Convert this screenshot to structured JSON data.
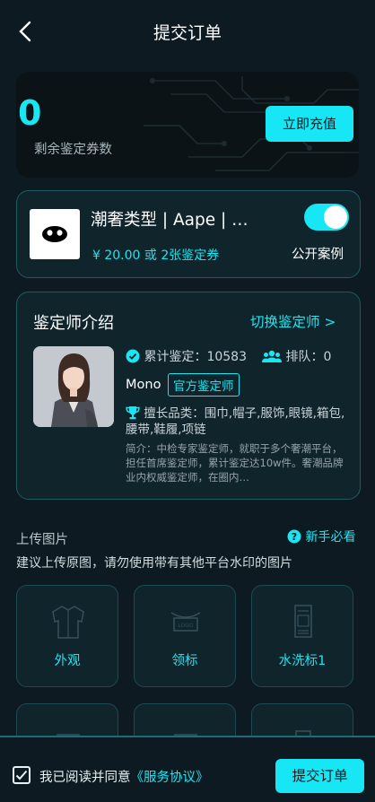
{
  "nav": {
    "title": "提交订单"
  },
  "balance": {
    "count": "0",
    "label": "剩余鉴定券数",
    "recharge_label": "立即充值"
  },
  "product": {
    "title": "潮奢类型 | Aape | …",
    "price": "¥ 20.00 或 2张鉴定券",
    "public_toggle_on": true,
    "public_label": "公开案例"
  },
  "appraiser": {
    "section_title": "鉴定师介绍",
    "switch_label": "切换鉴定师 >",
    "stat_count": "累计鉴定：10583",
    "stat_queue": "排队：0",
    "name": "Mono",
    "badge": "官方鉴定师",
    "skills": "擅长品类：围巾,帽子,服饰,眼镜,箱包,腰带,鞋履,项链",
    "intro": "简介：中检专家鉴定师，就职于多个奢潮平台，担任首席鉴定师，累计鉴定达10w件。奢潮品牌业内权威鉴定师，在圈内…"
  },
  "upload": {
    "title": "上传图片",
    "guide_label": "新手必看",
    "tip": "建议上传原图，请勿使用带有其他平台水印的图片",
    "tiles": [
      {
        "label": "外观",
        "icon": "jacket-icon"
      },
      {
        "label": "领标",
        "icon": "collar-label-icon"
      },
      {
        "label": "水洗标1",
        "icon": "wash-label-icon"
      }
    ]
  },
  "footer": {
    "agree_prefix": "我已阅读并同意",
    "agree_link": "《服务协议》",
    "submit_label": "提交订单",
    "checked": true
  },
  "colors": {
    "accent": "#17e7f4",
    "background": "#0d1a21",
    "card": "#10242c"
  }
}
